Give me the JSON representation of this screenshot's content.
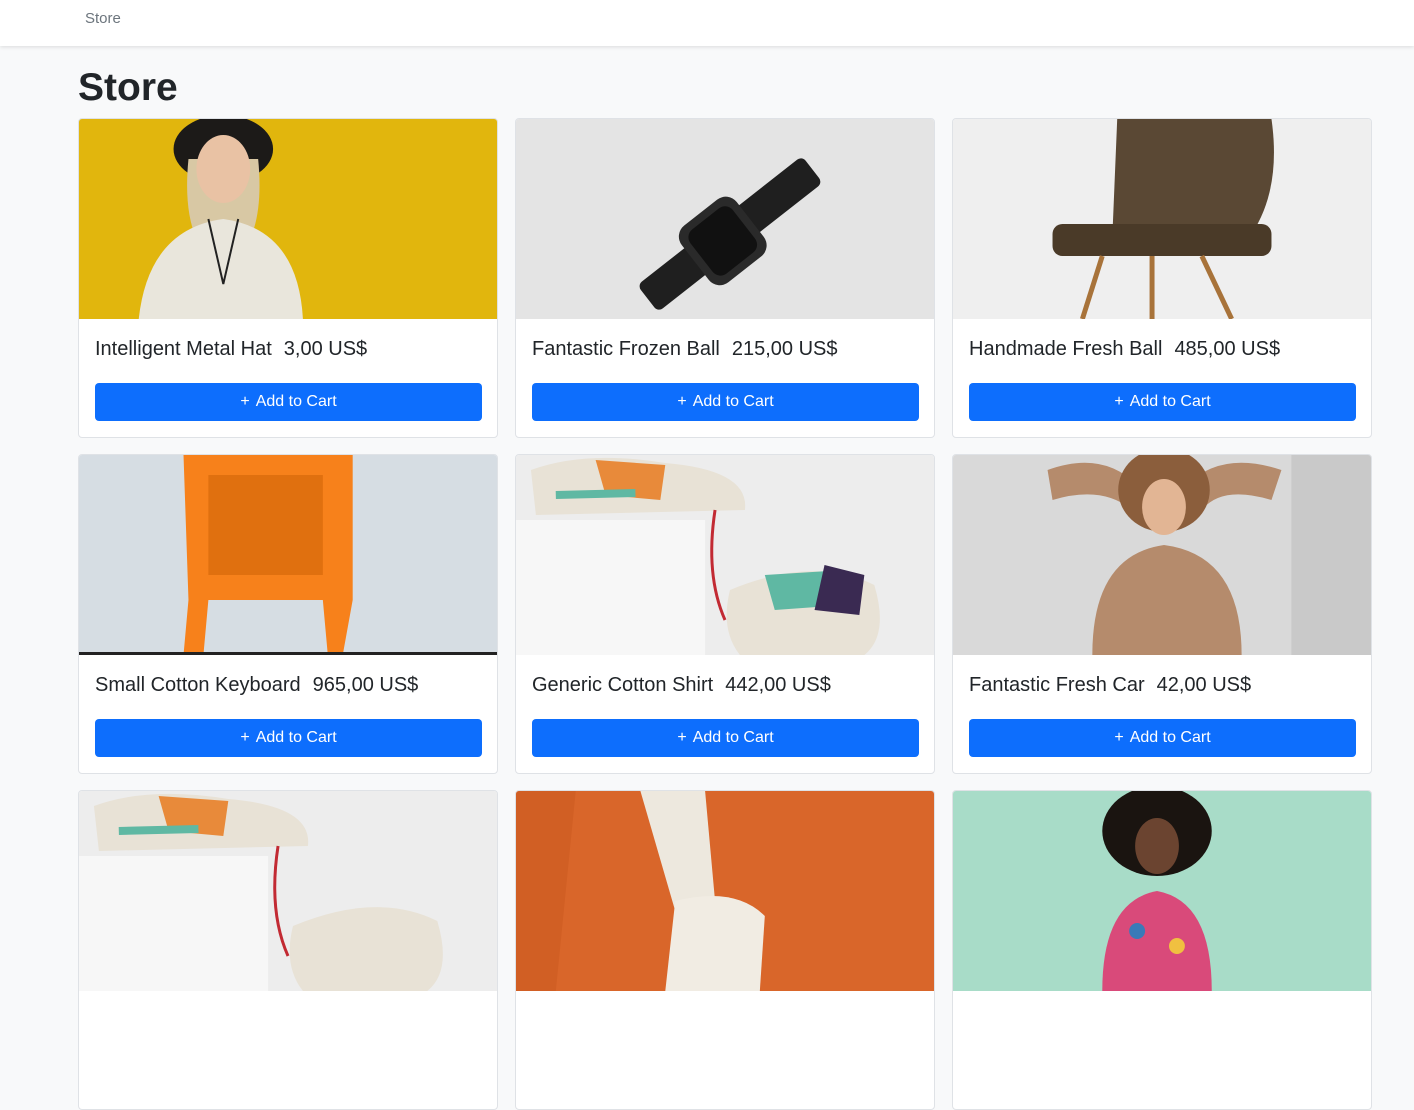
{
  "navbar": {
    "brand": "Store"
  },
  "page": {
    "title": "Store"
  },
  "products": [
    {
      "name": "Intelligent Metal Hat",
      "price": "3,00 US$",
      "button": "Add to Cart",
      "button_icon": "+",
      "image": "woman-yellow-wall"
    },
    {
      "name": "Fantastic Frozen Ball",
      "price": "215,00 US$",
      "button": "Add to Cart",
      "button_icon": "+",
      "image": "smart-watch"
    },
    {
      "name": "Handmade Fresh Ball",
      "price": "485,00 US$",
      "button": "Add to Cart",
      "button_icon": "+",
      "image": "brown-chair"
    },
    {
      "name": "Small Cotton Keyboard",
      "price": "965,00 US$",
      "button": "Add to Cart",
      "button_icon": "+",
      "image": "orange-chair"
    },
    {
      "name": "Generic Cotton Shirt",
      "price": "442,00 US$",
      "button": "Add to Cart",
      "button_icon": "+",
      "image": "sneakers"
    },
    {
      "name": "Fantastic Fresh Car",
      "price": "42,00 US$",
      "button": "Add to Cart",
      "button_icon": "+",
      "image": "woman-sweater"
    },
    {
      "image": "sneakers"
    },
    {
      "image": "white-shoe-orange"
    },
    {
      "image": "woman-mint"
    }
  ],
  "colors": {
    "primary": "#0d6efd",
    "background": "#f8f9fa"
  }
}
